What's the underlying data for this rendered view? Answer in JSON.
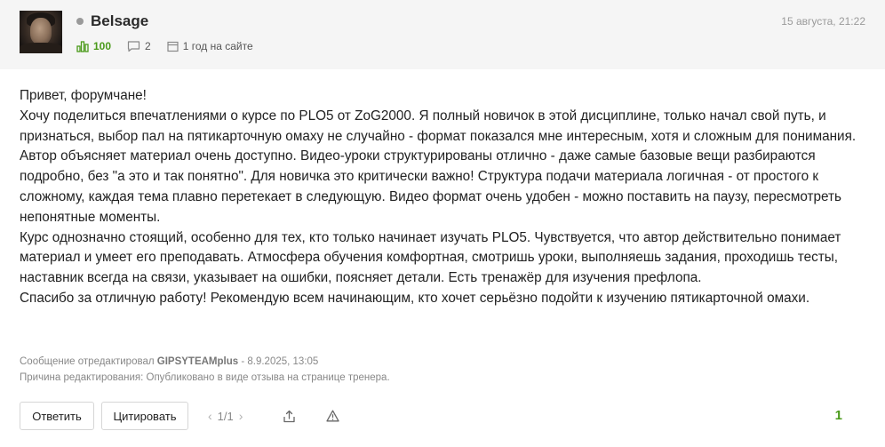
{
  "author": {
    "name": "Belsage",
    "rating": "100",
    "messages": "2",
    "member_since": "1 год на сайте"
  },
  "post": {
    "timestamp": "15 августа, 21:22",
    "paragraphs": [
      "Привет, форумчане!",
      "Хочу поделиться впечатлениями о курсе по PLO5 от ZoG2000. Я полный новичок в этой дисциплине, только начал свой путь, и признаться, выбор пал на пятикарточную омаху не случайно - формат показался мне интересным, хотя и сложным для понимания.",
      "Автор объясняет материал очень доступно. Видео-уроки структурированы отлично - даже самые базовые вещи разбираются подробно, без \"а это и так понятно\". Для новичка это критически важно! Структура подачи материала логичная - от простого к сложному, каждая тема плавно перетекает в следующую. Видео формат очень удобен - можно поставить на паузу, пересмотреть непонятные моменты.",
      "Курс однозначно стоящий, особенно для тех, кто только начинает изучать PLO5. Чувствуется, что автор действительно понимает материал и умеет его преподавать. Атмосфера обучения комфортная, смотришь уроки, выполняешь задания, проходишь тесты, наставник всегда на связи, указывает на ошибки, поясняет детали. Есть тренажёр для изучения префлопа.",
      "Спасибо за отличную работу! Рекомендую всем начинающим, кто хочет серьёзно подойти к изучению пятикарточной омахи."
    ],
    "edit": {
      "prefix": "Сообщение отредактировал",
      "editor": "GIPSYTEAMplus",
      "date": "- 8.9.2025, 13:05",
      "reason": "Причина редактирования: Опубликовано в виде отзыва на странице тренера."
    }
  },
  "footer": {
    "reply_label": "Ответить",
    "quote_label": "Цитировать",
    "pager": "1/1",
    "likes": "1"
  },
  "icons": {
    "rating": "bar-chart-icon",
    "messages": "speech-bubble-icon",
    "member": "calendar-icon",
    "share": "share-icon",
    "report": "warning-icon"
  },
  "colors": {
    "accent_green": "#4a9a1a",
    "header_bg": "#f5f5f5",
    "muted": "#9a9a9a"
  }
}
